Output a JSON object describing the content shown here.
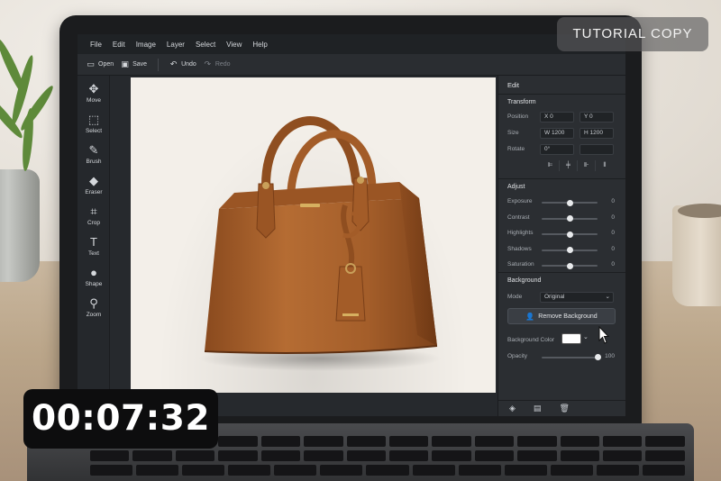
{
  "app": {
    "menus": [
      "File",
      "Edit",
      "Image",
      "Layer",
      "Select",
      "View",
      "Help"
    ],
    "toolbar": {
      "open_label": "Open",
      "save_label": "Save",
      "undo_label": "Undo",
      "redo_label": "Redo"
    },
    "tools": [
      {
        "label": "Move",
        "icon": "move-icon"
      },
      {
        "label": "Select",
        "icon": "select-icon"
      },
      {
        "label": "Brush",
        "icon": "brush-icon"
      },
      {
        "label": "Eraser",
        "icon": "eraser-icon"
      },
      {
        "label": "Crop",
        "icon": "crop-icon"
      },
      {
        "label": "Text",
        "icon": "text-icon"
      },
      {
        "label": "Shape",
        "icon": "shape-icon"
      },
      {
        "label": "Zoom",
        "icon": "zoom-icon"
      }
    ],
    "panel": {
      "title": "Edit",
      "transform": {
        "title": "Transform",
        "position_label": "Position",
        "x_value": "X   0",
        "y_value": "Y   0",
        "size_label": "Size",
        "w_value": "W   1200",
        "h_value": "H   1200",
        "rotate_label": "Rotate",
        "rotate_value": "0°"
      },
      "adjust": {
        "title": "Adjust",
        "sliders": [
          {
            "label": "Exposure",
            "value": "0",
            "level": 0.5
          },
          {
            "label": "Contrast",
            "value": "0",
            "level": 0.5
          },
          {
            "label": "Highlights",
            "value": "0",
            "level": 0.5
          },
          {
            "label": "Shadows",
            "value": "0",
            "level": 0.5
          },
          {
            "label": "Saturation",
            "value": "0",
            "level": 0.5
          }
        ]
      },
      "background": {
        "title": "Background",
        "mode_label": "Mode",
        "mode_value": "Original",
        "remove_label": "Remove Background",
        "color_label": "Background Color",
        "color_value": "#ffffff",
        "opacity_label": "Opacity",
        "opacity_value": "100",
        "opacity_level": 1.0
      }
    }
  },
  "overlay": {
    "badge": "TUTORIAL COPY",
    "timer": "00:07:32"
  },
  "colors": {
    "bag_leather": "#a8622e",
    "panel_bg": "#2b2e32",
    "canvas_bg": "#f3efe9"
  }
}
